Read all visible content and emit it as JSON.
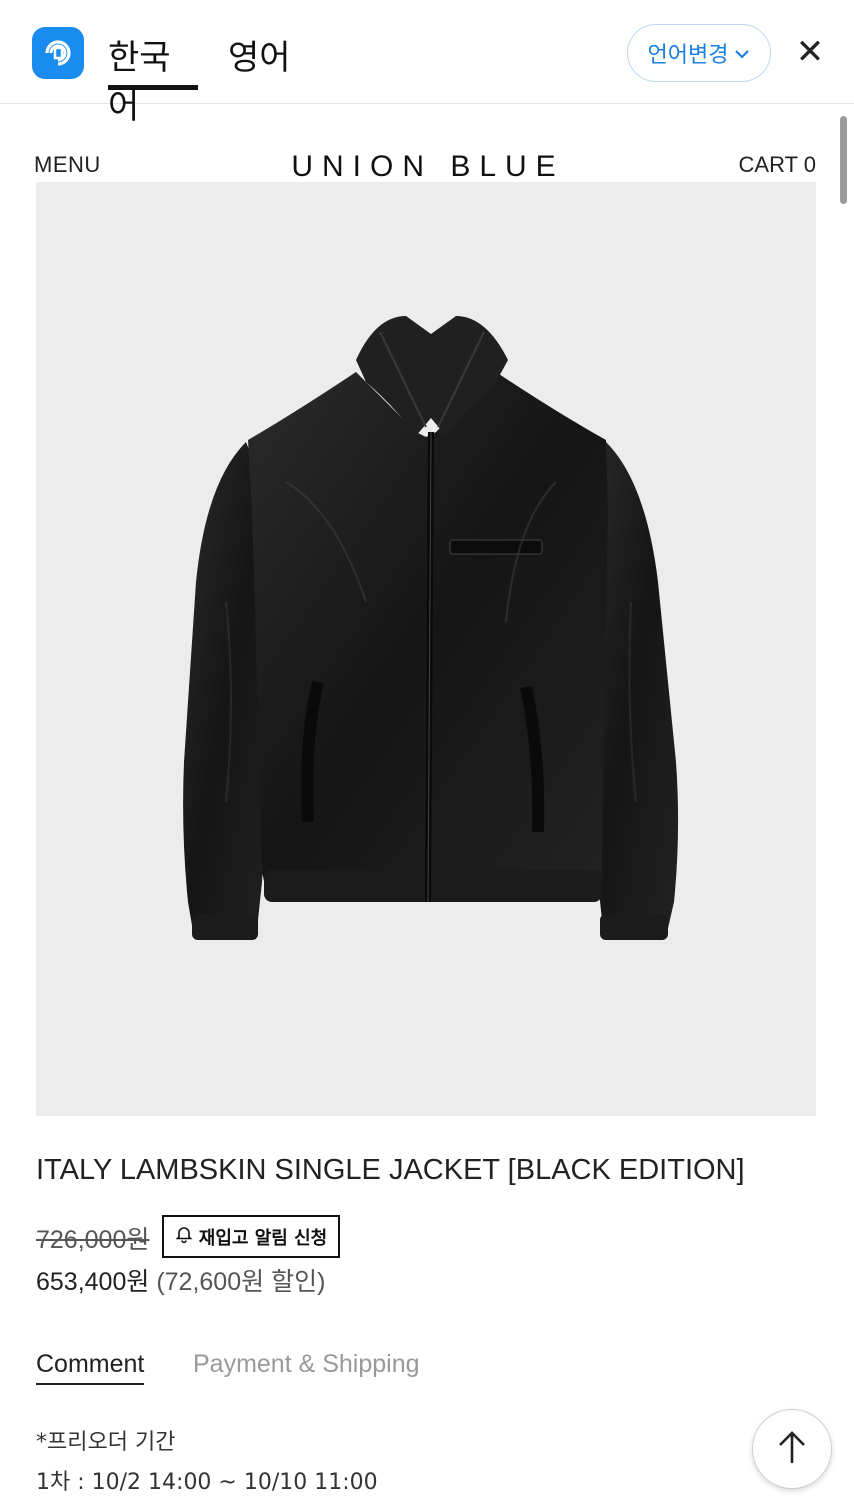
{
  "translation_bar": {
    "tab_korean": "한국어",
    "tab_english": "영어",
    "change_language_label": "언어변경",
    "close_symbol": "✕",
    "accent_color": "#1a8cf0"
  },
  "header": {
    "menu_label": "MENU",
    "brand": "UNION BLUE",
    "cart_label": "CART 0"
  },
  "product": {
    "title": "ITALY LAMBSKIN SINGLE JACKET  [BLACK EDITION]",
    "original_price": "726,000원",
    "restock_alert_label": "재입고 알림 신청",
    "sale_price": "653,400원",
    "discount_text": "(72,600원 할인)"
  },
  "tabs": {
    "comment": "Comment",
    "payment": "Payment & Shipping"
  },
  "preorder": {
    "title": "*프리오더 기간",
    "line1": "1차 : 10/2 14:00 ~ 10/10 11:00"
  },
  "icons": {
    "app": "translate-app-icon",
    "chevron": "chevron-down-icon",
    "bell": "bell-icon",
    "top": "arrow-up-icon"
  }
}
